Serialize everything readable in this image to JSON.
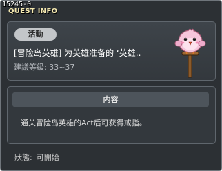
{
  "window": {
    "id": "15245-0",
    "title": "QUEST INFO"
  },
  "quest": {
    "category": "活動",
    "title": "[冒险岛英雄] 为英雄准备的 ‘英雄..",
    "level_req": "建議等級: 33~37",
    "icon": "pink-bird-signpost-icon"
  },
  "content": {
    "header": "内容",
    "text": "通关冒险岛英雄的Act后可获得戒指。"
  },
  "status": {
    "label": "狀態:",
    "value": "可開始"
  }
}
